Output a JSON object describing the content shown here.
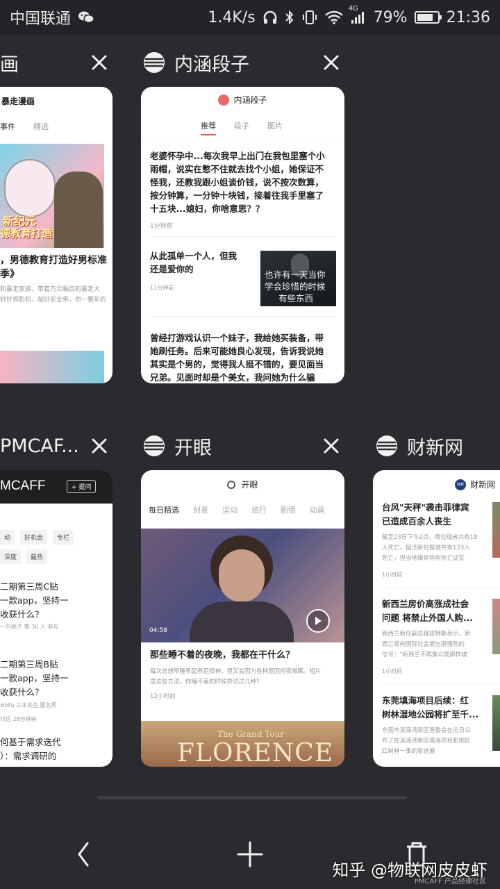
{
  "status_bar": {
    "carrier": "中国联通",
    "net_speed": "1.4K/s",
    "network": "4G",
    "battery": "79%",
    "battery_level": 0.79,
    "time": "21:36"
  },
  "tabs": {
    "t1": {
      "title": "画",
      "card": {
        "brand": "暴走漫画",
        "tabs": [
          "事件",
          "精选"
        ],
        "thumb_text": [
          "新纪元",
          "德教育打造"
        ],
        "headline": "，男德教育打造好男标准季》",
        "headline_l1": "，男德教育打造好男标准",
        "headline_l2": "季》",
        "desc_l1": "和暴走家族，带着万众瞩目的暴走大",
        "desc_l2": "好好观影机，敲好安全带，你一整年的"
      }
    },
    "t2": {
      "title": "内涵段子",
      "card": {
        "brand": "内涵段子",
        "tabs": [
          "推荐",
          "段子",
          "图片"
        ],
        "post1_l1": "老婆怀孕中...每次我早上出门在我包里塞个小",
        "post1_l2": "雨帽，说实在憋不住就去找个小姐，她保证不",
        "post1_l3": "怪我，还教我跟小姐谈价钱，说不按次数算，",
        "post1_l4": "按分钟算，一分钟十块钱，接着往我手里塞了",
        "post1_l5": "十五块...媳妇，你啥意思？？",
        "post1_time": "1分钟前",
        "post2_l1": "从此孤单一个人，但我",
        "post2_l2": "还是爱你的",
        "post2_time": "11分钟前",
        "post2_img_l1": "也许有一天当你",
        "post2_img_l2": "学会珍惜的时候",
        "post2_img_l3": "有些东西",
        "post3_l1": "曾经打游戏认识一个妹子，我给她买装备，带",
        "post3_l2": "她刷任务。后来可能她良心发现，告诉我说她",
        "post3_l3": "其实是个男的，觉得我人挺不错的，要见面当",
        "post3_l4": "兄弟。见面时却是个美女，我问她为什么骗"
      }
    },
    "t3": {
      "title": "PMCAF...",
      "card": {
        "brand": "MCAFF",
        "ask_btn": "+ 提问",
        "chips_row1": [
          "动",
          "好机会",
          "专栏"
        ],
        "chips_row2": [
          "深度",
          "最热"
        ],
        "item1_l1": "二期第三周C贴",
        "item1_l2": "一款app，坚持一",
        "item1_l3": "收获什么？",
        "item1_meta": "一只桃子 等 30 人 参与",
        "item2_l1": "二期第三周B贴",
        "item2_l2": "一款app，坚持一",
        "item2_l3": "收获什么？",
        "item2_meta": "#bFa 三木先生 匿名用",
        "item2_meta2": "讨论 28分钟前",
        "item3_l1": "何基于需求迭代",
        "item3_l2": "）：需求调研的"
      }
    },
    "t4": {
      "title": "开眼",
      "card": {
        "brand": "开眼",
        "tabs": [
          "每日精选",
          "创意",
          "运动",
          "旅行",
          "剧情",
          "动画"
        ],
        "duration": "04:58",
        "video_title": "那些睡不着的夜晚，我都在干什么？",
        "video_desc_l1": "每次总想早睡早起养足精神，但又会因为各种原因彻夜难眠。短片",
        "video_desc_l2": "里这些方法，你睡不着的时候尝试过几种？",
        "video_time": "12小时前",
        "poster_l1": "The Grand Tour",
        "poster_l2": "FLORENCE"
      }
    },
    "t5": {
      "title": "财新网",
      "card": {
        "brand": "财新网",
        "logo": "财新",
        "n1_l1": "台风\"天秤\"袭击菲律宾",
        "n1_l2": "已造成百余人丧生",
        "n1_d1": "截至23日下午2点，南拉瑙省共有18",
        "n1_d2": "人死亡。据法新社报道共有133人",
        "n1_d3": "死亡，但当地媒体称有伤亡证实",
        "n1_time": "1小时前",
        "n2_l1": "新西兰房价高涨成社会",
        "n2_l2": "问题 将禁止外国人购...",
        "n2_d1": "新西兰新任副总理皮特斯表示，新",
        "n2_d2": "西兰将向国际社会提出很强烈的",
        "n2_d3": "信号：\"新西兰不再像以前那样被",
        "n2_time": "1小时前",
        "n3_l1": "东莞填海项目后续：红",
        "n3_l2": "树林湿地公园将扩至千...",
        "n3_d1": "东莞市滨海湾新区管委会在近日公",
        "n3_d2": "布了在滨海湾新区填海项目影响区",
        "n3_d3": "红树林一事的新进展"
      }
    }
  },
  "watermark": {
    "main": "知乎 @物联网皮皮虾",
    "sub": "PMCAFF 产品经理社区"
  },
  "icons": [
    "close-icon",
    "globe-icon",
    "back-icon",
    "add-icon",
    "clear-all-icon",
    "play-icon"
  ]
}
